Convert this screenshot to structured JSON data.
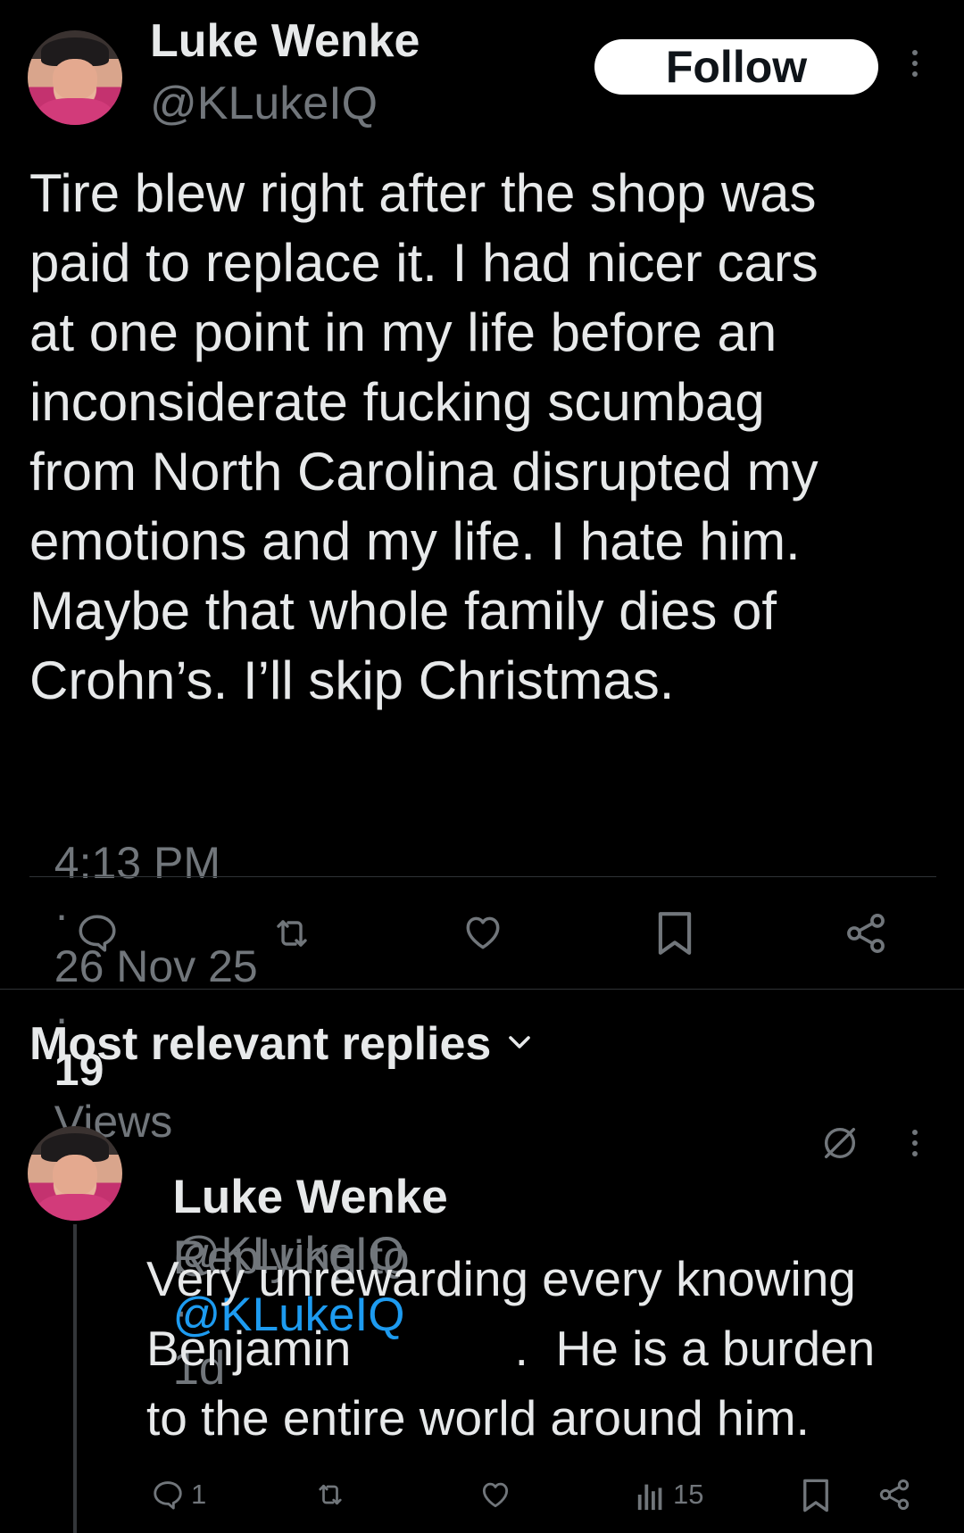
{
  "tweet": {
    "author_name": "Luke Wenke",
    "author_handle": "@KLukeIQ",
    "follow_label": "Follow",
    "text_lines": [
      "Tire blew right after the shop was",
      "paid to replace it.  I had nicer cars",
      "at one point in my life before an",
      "inconsiderate fucking scumbag",
      "from North Carolina disrupted my",
      "emotions and my life.  I hate him.",
      "Maybe that whole family dies of",
      "Crohn’s.  I’ll skip Christmas."
    ],
    "time": "4:13 PM",
    "sep": "·",
    "date": "26 Nov 25",
    "views_count": "19",
    "views_label": "Views",
    "actions": [
      "reply-icon",
      "retweet-icon",
      "like-icon",
      "bookmark-icon",
      "share-icon"
    ]
  },
  "replies_header": {
    "label": "Most relevant replies"
  },
  "reply": {
    "author_name": "Luke Wenke",
    "author_handle": "@KLukeIQ",
    "sep": "·",
    "age": "1d",
    "replying_to_label": "Replying to",
    "replying_to_handle": "@KLukeIQ",
    "text_lines": [
      "Very unrewarding every knowing",
      "Benjamin            .  He is a burden",
      "to the entire world around him."
    ],
    "reply_count": "1",
    "views_count": "15",
    "actions": [
      "reply-icon",
      "retweet-icon",
      "like-icon",
      "views-icon",
      "bookmark-icon",
      "share-icon"
    ]
  },
  "colors": {
    "background": "#000000",
    "text": "#e7e9ea",
    "muted": "#71767b",
    "link": "#1d9bf0",
    "divider": "#2f3336"
  }
}
